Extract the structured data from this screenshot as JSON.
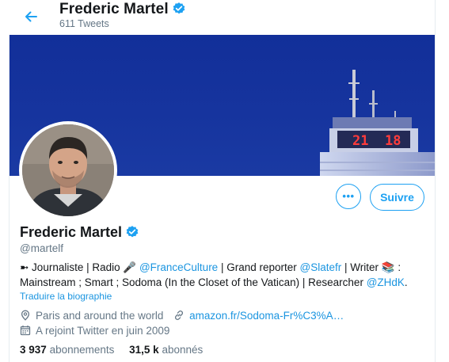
{
  "header": {
    "name": "Frederic Martel",
    "tweet_count": "611 Tweets"
  },
  "banner": {
    "clock_hours": "21",
    "clock_minutes": "18"
  },
  "actions": {
    "more_label": "•••",
    "follow_label": "Suivre"
  },
  "profile": {
    "name": "Frederic Martel",
    "handle": "@martelf",
    "bio": {
      "part1": "➼ Journaliste | Radio 🎤 ",
      "mention1": "@FranceCulture",
      "part2": " | Grand reporter ",
      "mention2": "@Slatefr",
      "part3": " | Writer 📚 : Mainstream ; Smart ; Sodoma (In the Closet of the Vatican) | Researcher ",
      "mention3": "@ZHdK",
      "part4": "."
    },
    "translate_label": "Traduire la biographie",
    "location": "Paris and around the world",
    "website": "amazon.fr/Sodoma-Fr%C3%A…",
    "joined": "A rejoint Twitter en juin 2009"
  },
  "stats": {
    "following_count": "3 937",
    "following_label": "abonnements",
    "followers_count": "31,5 k",
    "followers_label": "abonnés"
  },
  "colors": {
    "accent": "#1da1f2",
    "link": "#1b95e0",
    "secondary_text": "#657786",
    "banner_sky": "#16349e",
    "clock_digits": "#ff3b3b"
  }
}
